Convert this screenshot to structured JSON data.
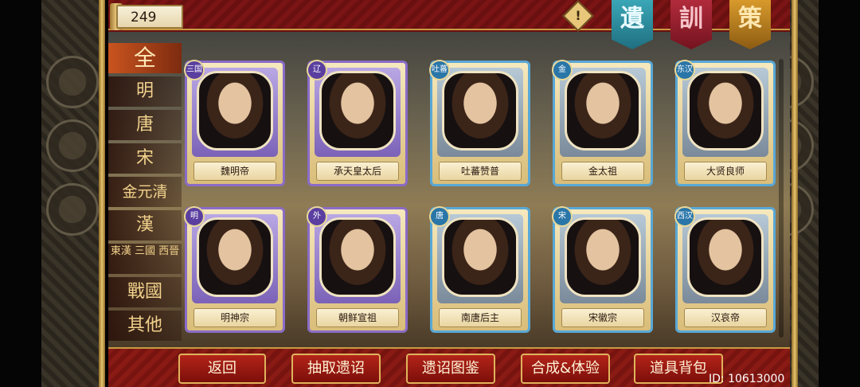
{
  "currency": {
    "value": "249"
  },
  "warning_icon": "!",
  "banners": [
    "遺",
    "訓",
    "策"
  ],
  "tabs": [
    {
      "label": "全",
      "active": true
    },
    {
      "label": "明"
    },
    {
      "label": "唐"
    },
    {
      "label": "宋"
    },
    {
      "label": "金元清"
    },
    {
      "label": "漢"
    },
    {
      "label": "東漢 三國 西晉",
      "small": true
    },
    {
      "label": "戰國"
    },
    {
      "label": "其他"
    }
  ],
  "cards": [
    {
      "era": "三国",
      "name": "魏明帝",
      "frame": "purple"
    },
    {
      "era": "辽",
      "name": "承天皇太后",
      "frame": "purple"
    },
    {
      "era": "吐蕃",
      "name": "吐蕃赞普",
      "frame": "blue"
    },
    {
      "era": "金",
      "name": "金太祖",
      "frame": "blue"
    },
    {
      "era": "东汉",
      "name": "大贤良师",
      "frame": "blue"
    },
    {
      "era": "明",
      "name": "明神宗",
      "frame": "purple"
    },
    {
      "era": "外",
      "name": "朝鲜宣祖",
      "frame": "purple"
    },
    {
      "era": "唐",
      "name": "南唐后主",
      "frame": "blue"
    },
    {
      "era": "宋",
      "name": "宋徽宗",
      "frame": "blue"
    },
    {
      "era": "西汉",
      "name": "汉哀帝",
      "frame": "blue"
    }
  ],
  "buttons": {
    "back": "返回",
    "draw": "抽取遗诏",
    "gallery": "遗诏图鉴",
    "compose": "合成&体验",
    "bag": "道具背包"
  },
  "uid": "ID: 10613000"
}
